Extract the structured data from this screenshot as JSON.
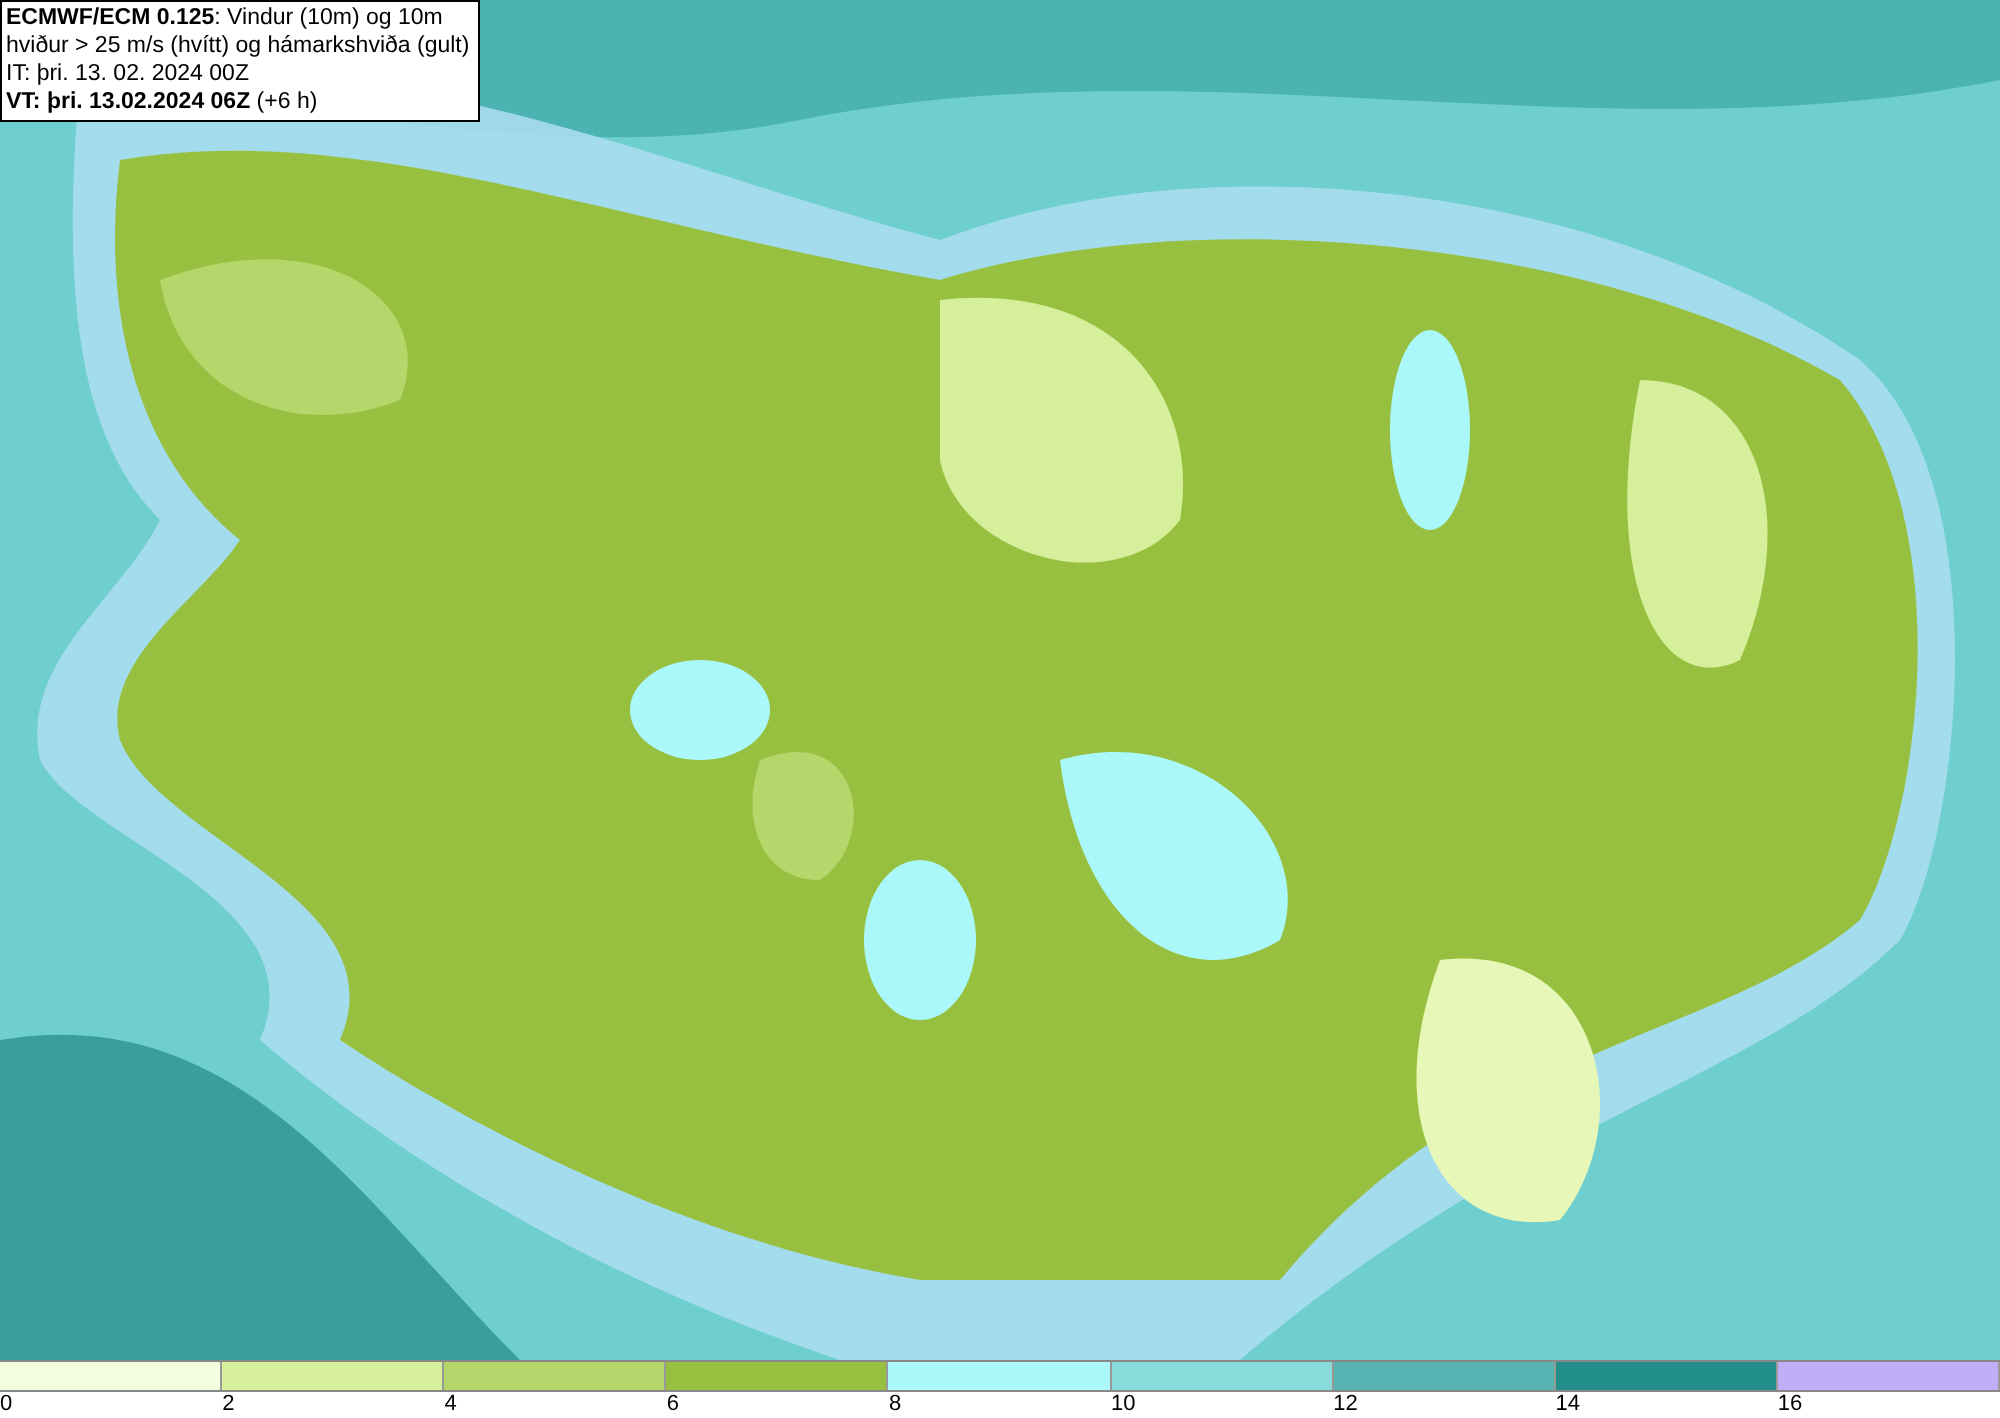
{
  "info_box": {
    "lines": [
      "**ECMWF/ECM 0.125**: Vindur (10m) og 10m",
      "hviður > 25 m/s (hvítt) og hámarkshviða (gult)",
      "IT: þri. 13. 02. 2024 00Z",
      "**VT: þri. 13.02.2024 06Z** (+6 h)"
    ]
  },
  "legend": {
    "segments": [
      {
        "color": "#f5fde0"
      },
      {
        "color": "#d5ef9a"
      },
      {
        "color": "#b4d66a"
      },
      {
        "color": "#98c040"
      },
      {
        "color": "#aaf8fa"
      },
      {
        "color": "#88dcdc"
      },
      {
        "color": "#55b4b2"
      },
      {
        "color": "#238f8a"
      },
      {
        "color": "#c0aef8"
      }
    ],
    "ticks": [
      "0",
      "2",
      "4",
      "6",
      "8",
      "10",
      "12",
      "14",
      "16"
    ]
  }
}
